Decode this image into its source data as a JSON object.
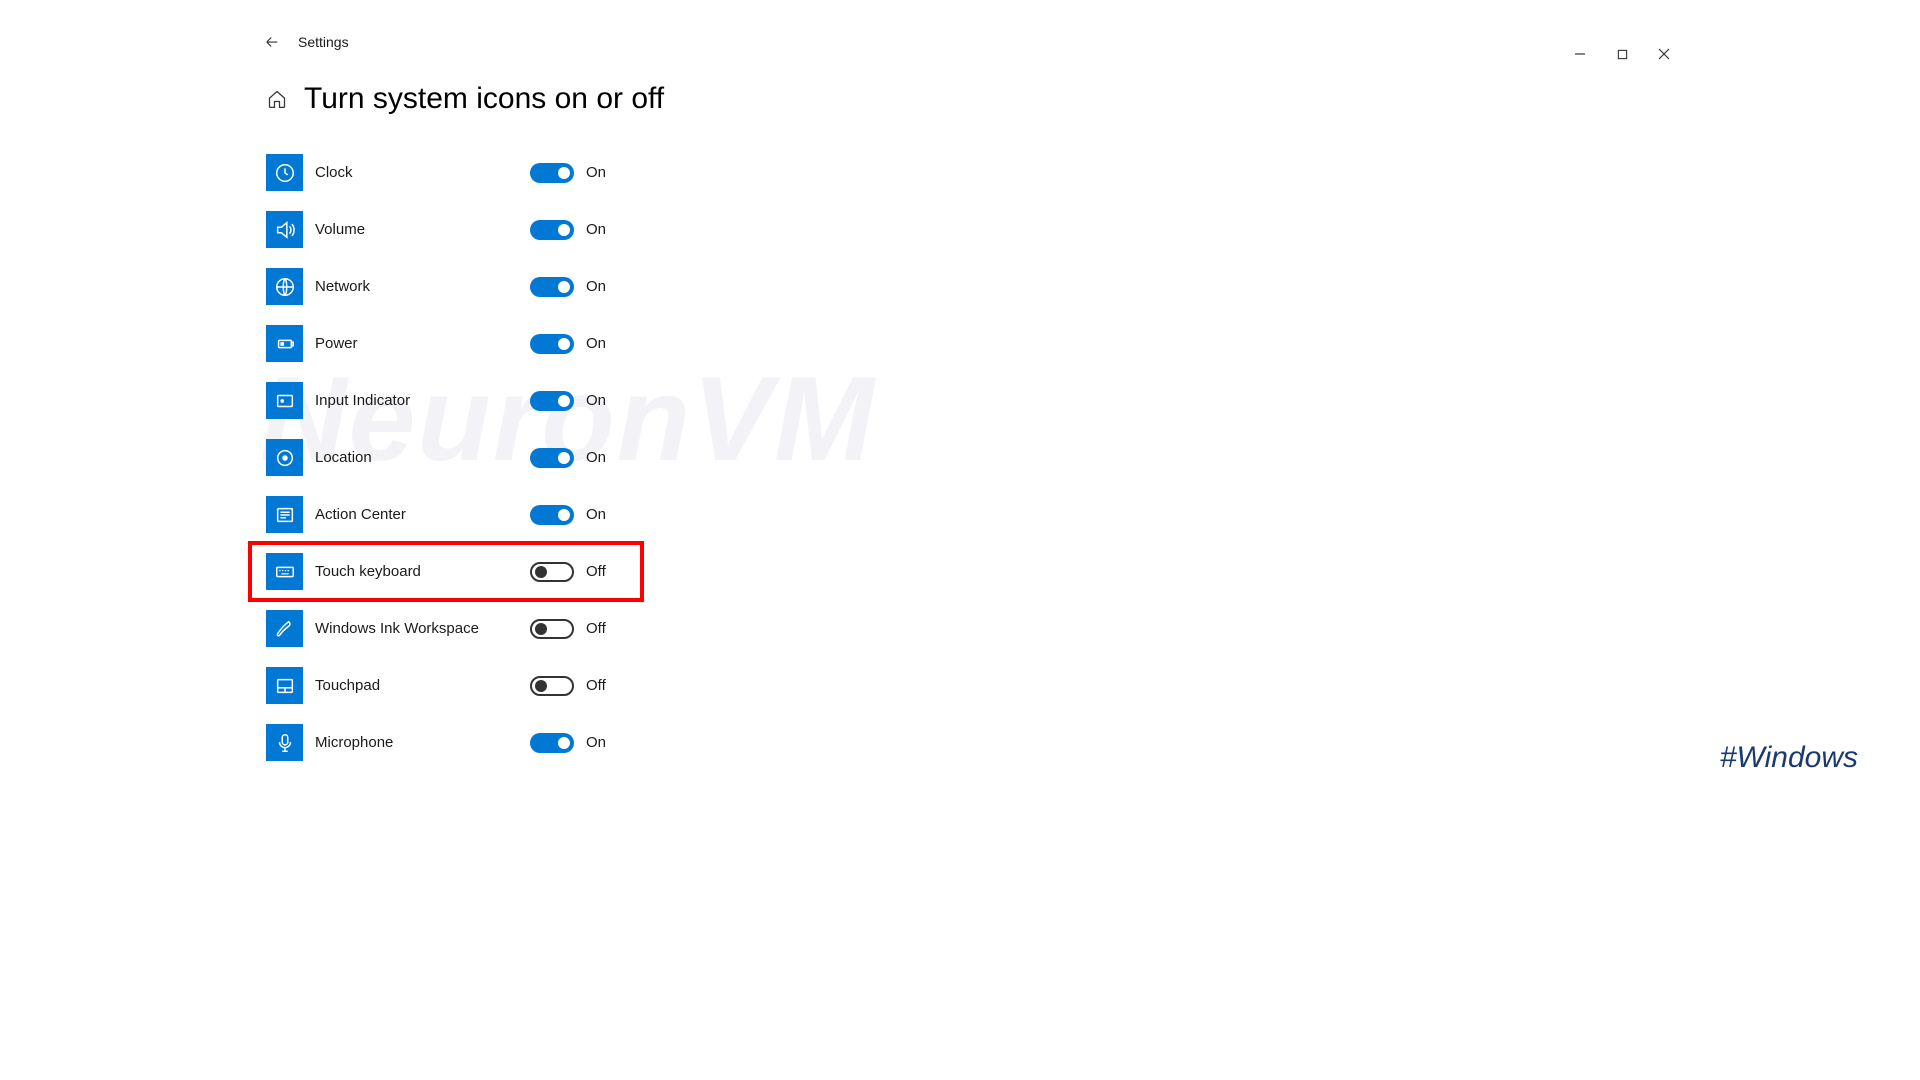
{
  "app": {
    "title": "Settings"
  },
  "page": {
    "title": "Turn system icons on or off"
  },
  "labels": {
    "on": "On",
    "off": "Off"
  },
  "items": [
    {
      "label": "Clock",
      "state": "on",
      "highlight": false,
      "icon": "clock"
    },
    {
      "label": "Volume",
      "state": "on",
      "highlight": false,
      "icon": "volume"
    },
    {
      "label": "Network",
      "state": "on",
      "highlight": false,
      "icon": "network"
    },
    {
      "label": "Power",
      "state": "on",
      "highlight": false,
      "icon": "power"
    },
    {
      "label": "Input Indicator",
      "state": "on",
      "highlight": false,
      "icon": "input"
    },
    {
      "label": "Location",
      "state": "on",
      "highlight": false,
      "icon": "location"
    },
    {
      "label": "Action Center",
      "state": "on",
      "highlight": false,
      "icon": "action"
    },
    {
      "label": "Touch keyboard",
      "state": "off",
      "highlight": true,
      "icon": "keyboard"
    },
    {
      "label": "Windows Ink Workspace",
      "state": "off",
      "highlight": false,
      "icon": "ink"
    },
    {
      "label": "Touchpad",
      "state": "off",
      "highlight": false,
      "icon": "touchpad"
    },
    {
      "label": "Microphone",
      "state": "on",
      "highlight": false,
      "icon": "mic"
    }
  ],
  "watermark": "NeuronVM",
  "hashtag": "#Windows"
}
